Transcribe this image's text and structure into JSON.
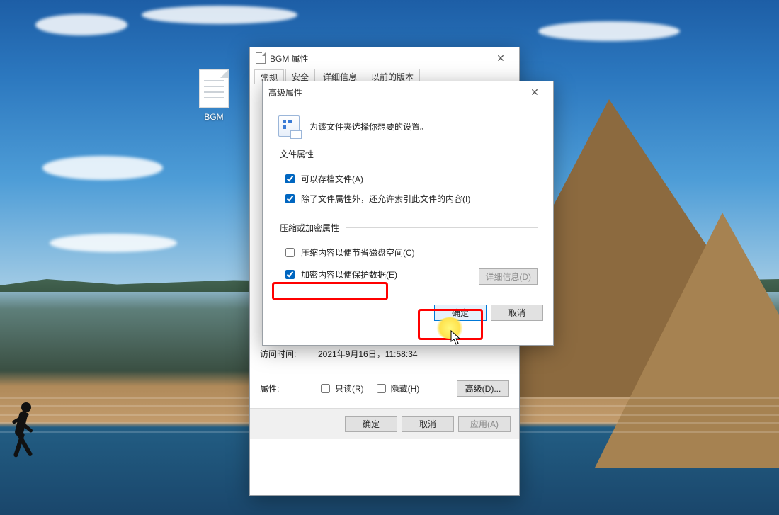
{
  "desktop": {
    "file_label": "BGM"
  },
  "props_window": {
    "title": "BGM 属性",
    "tabs": [
      "常规",
      "安全",
      "详细信息",
      "以前的版本"
    ],
    "active_tab": 0,
    "filename": "BGM",
    "access_time_label": "访问时间:",
    "access_time_value": "2021年9月16日，11:58:34",
    "attr_label": "属性:",
    "readonly_label": "只读(R)",
    "hidden_label": "隐藏(H)",
    "advanced_btn": "高级(D)...",
    "ok": "确定",
    "cancel": "取消",
    "apply": "应用(A)"
  },
  "adv_dialog": {
    "title": "高级属性",
    "intro": "为该文件夹选择你想要的设置。",
    "group1_legend": "文件属性",
    "archive_label": "可以存档文件(A)",
    "index_label": "除了文件属性外，还允许索引此文件的内容(I)",
    "group2_legend": "压缩或加密属性",
    "compress_label": "压缩内容以便节省磁盘空间(C)",
    "encrypt_label": "加密内容以便保护数据(E)",
    "details_btn": "详细信息(D)",
    "ok": "确定",
    "cancel": "取消",
    "state": {
      "archive": true,
      "index": true,
      "compress": false,
      "encrypt": true
    }
  }
}
